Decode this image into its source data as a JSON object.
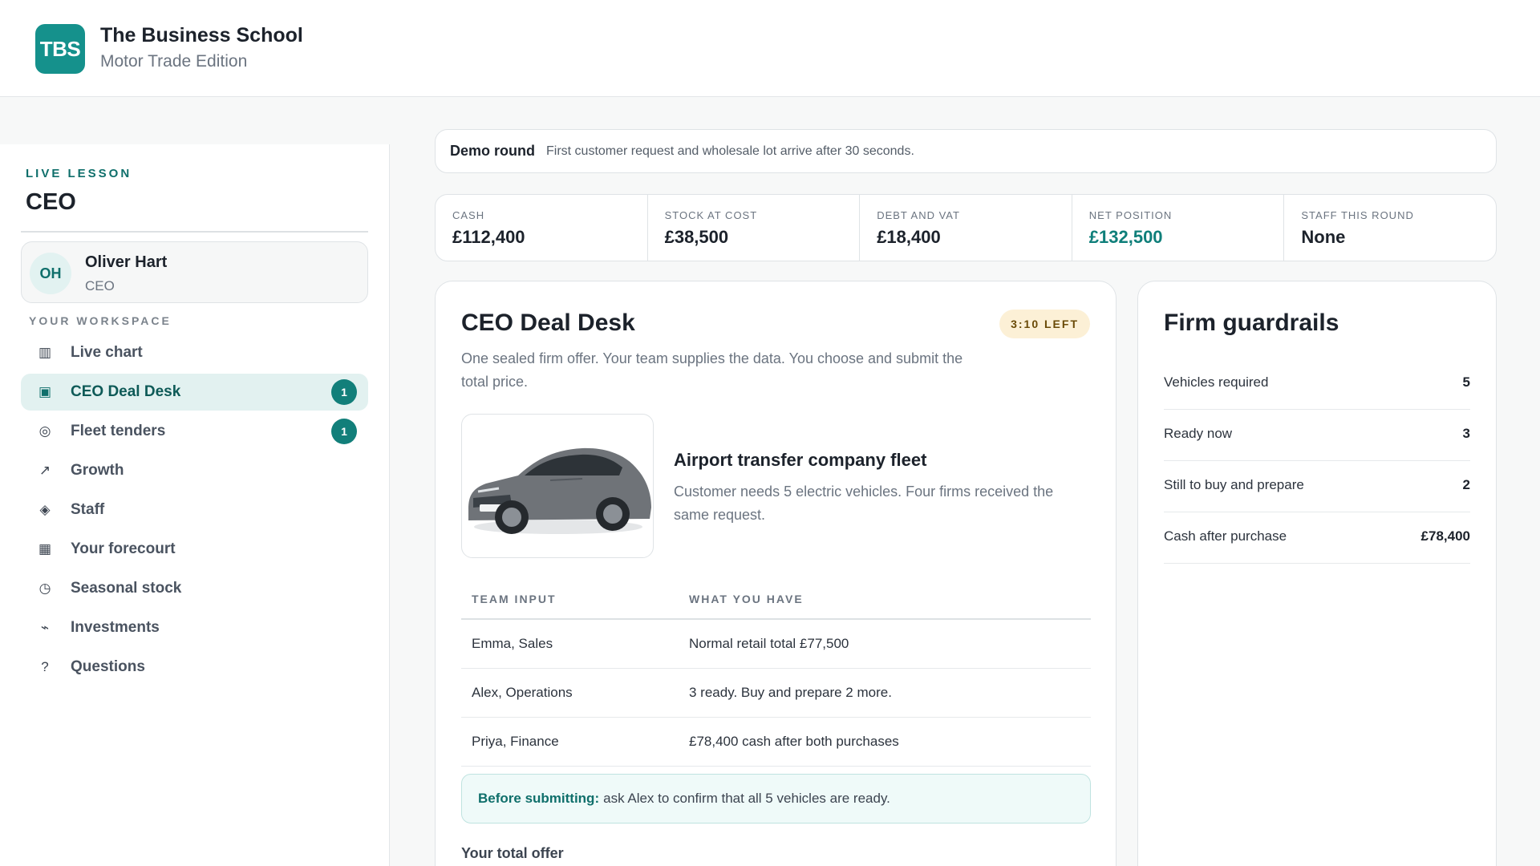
{
  "brand": {
    "logo": "TBS",
    "title": "The Business School",
    "subtitle": "Motor Trade Edition"
  },
  "sidebar": {
    "lesson_label": "LIVE LESSON",
    "role": "CEO",
    "user": {
      "initials": "OH",
      "name": "Oliver Hart",
      "role": "CEO"
    },
    "workspace_label": "YOUR WORKSPACE",
    "items": [
      {
        "label": "Live chart",
        "icon": "bar-chart-icon",
        "glyph": "▥",
        "badge": ""
      },
      {
        "label": "CEO Deal Desk",
        "icon": "desk-icon",
        "glyph": "▣",
        "badge": "1",
        "active": true
      },
      {
        "label": "Fleet tenders",
        "icon": "target-icon",
        "glyph": "◎",
        "badge": "1"
      },
      {
        "label": "Growth",
        "icon": "growth-arrow-icon",
        "glyph": "↗",
        "badge": ""
      },
      {
        "label": "Staff",
        "icon": "diamond-icon",
        "glyph": "◈",
        "badge": ""
      },
      {
        "label": "Your forecourt",
        "icon": "grid-icon",
        "glyph": "▦",
        "badge": ""
      },
      {
        "label": "Seasonal stock",
        "icon": "clock-icon",
        "glyph": "◷",
        "badge": ""
      },
      {
        "label": "Investments",
        "icon": "trend-icon",
        "glyph": "⌁",
        "badge": ""
      },
      {
        "label": "Questions",
        "icon": "question-icon",
        "glyph": "?",
        "badge": ""
      }
    ]
  },
  "round": {
    "title": "Demo round",
    "description": "First customer request and wholesale lot arrive after 30 seconds."
  },
  "stats": [
    {
      "label": "CASH",
      "value": "£112,400"
    },
    {
      "label": "STOCK AT COST",
      "value": "£38,500"
    },
    {
      "label": "DEBT AND VAT",
      "value": "£18,400"
    },
    {
      "label": "NET POSITION",
      "value": "£132,500",
      "accent": true
    },
    {
      "label": "STAFF THIS ROUND",
      "value": "None"
    }
  ],
  "deal": {
    "title": "CEO Deal Desk",
    "timer": "3:10 LEFT",
    "description": "One sealed firm offer. Your team supplies the data. You choose and submit the total price.",
    "request_title": "Airport transfer company fleet",
    "request_description": "Customer needs 5 electric vehicles. Four firms received the same request.",
    "table": {
      "headers": [
        "TEAM INPUT",
        "WHAT YOU HAVE"
      ],
      "rows": [
        [
          "Emma, Sales",
          "Normal retail total £77,500"
        ],
        [
          "Alex, Operations",
          "3 ready. Buy and prepare 2 more."
        ],
        [
          "Priya, Finance",
          "£78,400 cash after both purchases"
        ]
      ]
    },
    "note_strong": "Before submitting:",
    "note_text": "ask Alex to confirm that all 5 vehicles are ready.",
    "offer_label": "Your total offer"
  },
  "guardrails": {
    "title": "Firm guardrails",
    "rows": [
      {
        "label": "Vehicles required",
        "value": "5"
      },
      {
        "label": "Ready now",
        "value": "3"
      },
      {
        "label": "Still to buy and prepare",
        "value": "2"
      },
      {
        "label": "Cash after purchase",
        "value": "£78,400"
      }
    ]
  },
  "colors": {
    "accent": "#15918c",
    "accent_dark": "#0f6f6b",
    "timer_bg": "#fcf0d6",
    "car_body": "#6f7378"
  }
}
